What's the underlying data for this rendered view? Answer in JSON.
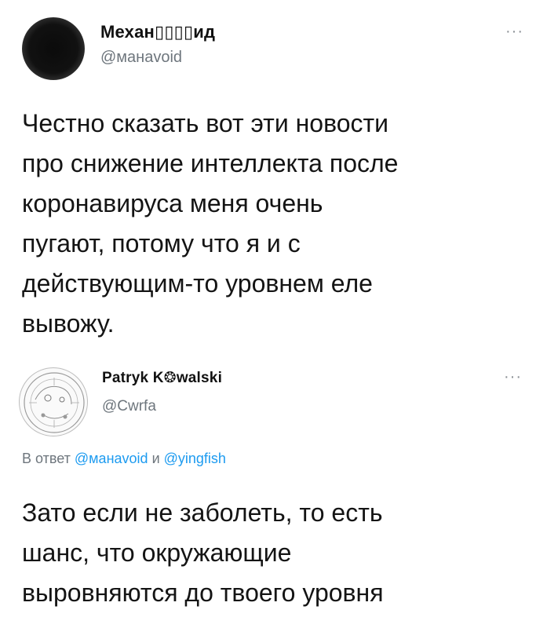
{
  "tweets": [
    {
      "author": {
        "name": "Механ▯▯▯▯ид",
        "handle": "@манаvoid"
      },
      "more_label": "···",
      "text": "Честно сказать вот эти новости\nпро снижение интеллекта после\nкоронавируса меня очень\nпугают, потому что я и с\nдействующим-то уровнем еле\nвывожу."
    },
    {
      "author": {
        "name": "Patryk K❂walski",
        "handle": "@Cwrfa"
      },
      "more_label": "···",
      "reply_to": {
        "prefix": "В ответ",
        "mention1": "@манаvoidи",
        "conj": "и",
        "mention2": "@yingfish"
      },
      "text": "Зато если не заболеть, то есть\nшанс, что окружающие\nвыровняются до твоего уровня"
    }
  ]
}
